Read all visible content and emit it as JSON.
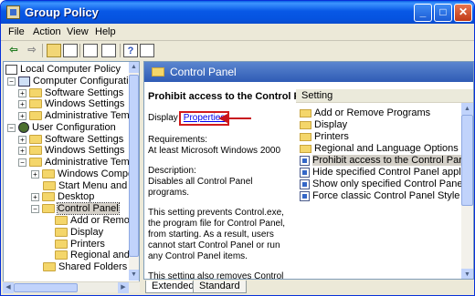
{
  "window": {
    "title": "Group Policy",
    "controls": {
      "minimize": "_",
      "maximize": "□",
      "close": "✕"
    }
  },
  "menubar": {
    "items": [
      "File",
      "Action",
      "View",
      "Help"
    ]
  },
  "toolbar": {
    "icons": [
      "back-arrow-icon",
      "forward-arrow-icon",
      "up-folder-icon",
      "show-tree-icon",
      "properties-icon",
      "list-icon",
      "help-icon",
      "show-pane-icon"
    ],
    "glyphs": {
      "back": "⇦",
      "forward": "⇨",
      "help": "?"
    }
  },
  "tree": {
    "items": [
      {
        "label": "Local Computer Policy",
        "icon": "policy",
        "level": 0,
        "expander": ""
      },
      {
        "label": "Computer Configuration",
        "icon": "pc",
        "level": 1,
        "expander": "−"
      },
      {
        "label": "Software Settings",
        "icon": "folder",
        "level": 2,
        "expander": "+"
      },
      {
        "label": "Windows Settings",
        "icon": "folder",
        "level": 2,
        "expander": "+"
      },
      {
        "label": "Administrative Templates",
        "icon": "folder",
        "level": 2,
        "expander": "+"
      },
      {
        "label": "User Configuration",
        "icon": "user",
        "level": 1,
        "expander": "−"
      },
      {
        "label": "Software Settings",
        "icon": "folder",
        "level": 2,
        "expander": "+"
      },
      {
        "label": "Windows Settings",
        "icon": "folder",
        "level": 2,
        "expander": "+"
      },
      {
        "label": "Administrative Templates",
        "icon": "folder",
        "level": 2,
        "expander": "−"
      },
      {
        "label": "Windows Components",
        "icon": "folder",
        "level": 3,
        "expander": "+"
      },
      {
        "label": "Start Menu and Taskba",
        "icon": "folder",
        "level": 3,
        "expander": ""
      },
      {
        "label": "Desktop",
        "icon": "folder",
        "level": 3,
        "expander": "+"
      },
      {
        "label": "Control Panel",
        "icon": "folder",
        "level": 3,
        "expander": "−",
        "selected": true
      },
      {
        "label": "Add or Remove P",
        "icon": "folder",
        "level": 4,
        "expander": ""
      },
      {
        "label": "Display",
        "icon": "folder",
        "level": 4,
        "expander": ""
      },
      {
        "label": "Printers",
        "icon": "folder",
        "level": 4,
        "expander": ""
      },
      {
        "label": "Regional and Lang",
        "icon": "folder",
        "level": 4,
        "expander": ""
      },
      {
        "label": "Shared Folders",
        "icon": "folder",
        "level": 3,
        "expander": ""
      }
    ]
  },
  "right_pane": {
    "header_title": "Control Panel",
    "description": {
      "heading": "Prohibit access to the Control Panel",
      "display_prefix": "Display",
      "properties_link": "Properties",
      "requirements_label": "Requirements:",
      "requirements_value": "At least Microsoft Windows 2000",
      "description_label": "Description:",
      "description_text": "Disables all Control Panel programs.",
      "paragraph_1": "This setting prevents Control.exe, the program file for Control Panel, from starting. As a result, users cannot start Control Panel or run any Control Panel items.",
      "paragraph_2": "This setting also removes Control Panel from the Start menu. (To open Control Panel, click Start, point to"
    },
    "list": {
      "column_header": "Setting",
      "rows": [
        {
          "label": "Add or Remove Programs",
          "icon": "folder"
        },
        {
          "label": "Display",
          "icon": "folder"
        },
        {
          "label": "Printers",
          "icon": "folder"
        },
        {
          "label": "Regional and Language Options",
          "icon": "folder"
        },
        {
          "label": "Prohibit access to the Control Panel",
          "icon": "setting",
          "selected": true
        },
        {
          "label": "Hide specified Control Panel applets",
          "icon": "setting"
        },
        {
          "label": "Show only specified Control Panel applets",
          "icon": "setting"
        },
        {
          "label": "Force classic Control Panel Style",
          "icon": "setting"
        }
      ]
    }
  },
  "tabs": [
    "Extended",
    "Standard"
  ],
  "colors": {
    "title_bar": "#0553e0",
    "pane_header": "#2f5bb5",
    "highlight_box": "#d21b1b",
    "link": "#0000ee"
  }
}
